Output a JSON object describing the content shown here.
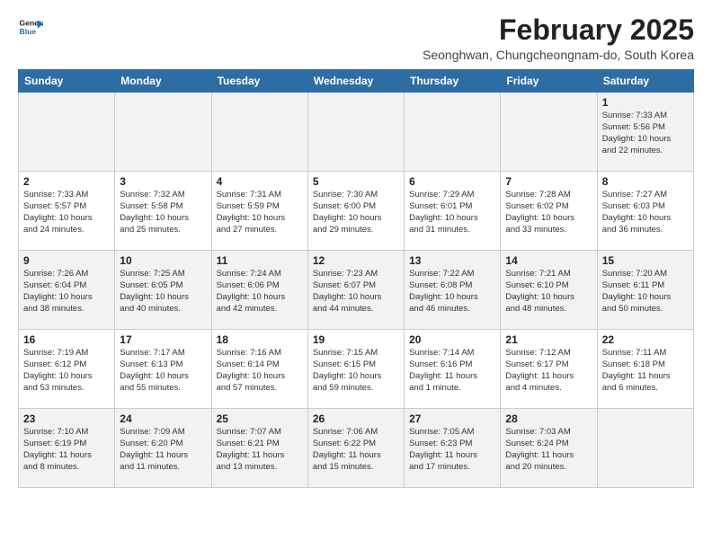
{
  "header": {
    "logo_line1": "General",
    "logo_line2": "Blue",
    "main_title": "February 2025",
    "subtitle": "Seonghwan, Chungcheongnam-do, South Korea"
  },
  "weekdays": [
    "Sunday",
    "Monday",
    "Tuesday",
    "Wednesday",
    "Thursday",
    "Friday",
    "Saturday"
  ],
  "weeks": [
    [
      {
        "day": "",
        "info": ""
      },
      {
        "day": "",
        "info": ""
      },
      {
        "day": "",
        "info": ""
      },
      {
        "day": "",
        "info": ""
      },
      {
        "day": "",
        "info": ""
      },
      {
        "day": "",
        "info": ""
      },
      {
        "day": "1",
        "info": "Sunrise: 7:33 AM\nSunset: 5:56 PM\nDaylight: 10 hours\nand 22 minutes."
      }
    ],
    [
      {
        "day": "2",
        "info": "Sunrise: 7:33 AM\nSunset: 5:57 PM\nDaylight: 10 hours\nand 24 minutes."
      },
      {
        "day": "3",
        "info": "Sunrise: 7:32 AM\nSunset: 5:58 PM\nDaylight: 10 hours\nand 25 minutes."
      },
      {
        "day": "4",
        "info": "Sunrise: 7:31 AM\nSunset: 5:59 PM\nDaylight: 10 hours\nand 27 minutes."
      },
      {
        "day": "5",
        "info": "Sunrise: 7:30 AM\nSunset: 6:00 PM\nDaylight: 10 hours\nand 29 minutes."
      },
      {
        "day": "6",
        "info": "Sunrise: 7:29 AM\nSunset: 6:01 PM\nDaylight: 10 hours\nand 31 minutes."
      },
      {
        "day": "7",
        "info": "Sunrise: 7:28 AM\nSunset: 6:02 PM\nDaylight: 10 hours\nand 33 minutes."
      },
      {
        "day": "8",
        "info": "Sunrise: 7:27 AM\nSunset: 6:03 PM\nDaylight: 10 hours\nand 36 minutes."
      }
    ],
    [
      {
        "day": "9",
        "info": "Sunrise: 7:26 AM\nSunset: 6:04 PM\nDaylight: 10 hours\nand 38 minutes."
      },
      {
        "day": "10",
        "info": "Sunrise: 7:25 AM\nSunset: 6:05 PM\nDaylight: 10 hours\nand 40 minutes."
      },
      {
        "day": "11",
        "info": "Sunrise: 7:24 AM\nSunset: 6:06 PM\nDaylight: 10 hours\nand 42 minutes."
      },
      {
        "day": "12",
        "info": "Sunrise: 7:23 AM\nSunset: 6:07 PM\nDaylight: 10 hours\nand 44 minutes."
      },
      {
        "day": "13",
        "info": "Sunrise: 7:22 AM\nSunset: 6:08 PM\nDaylight: 10 hours\nand 46 minutes."
      },
      {
        "day": "14",
        "info": "Sunrise: 7:21 AM\nSunset: 6:10 PM\nDaylight: 10 hours\nand 48 minutes."
      },
      {
        "day": "15",
        "info": "Sunrise: 7:20 AM\nSunset: 6:11 PM\nDaylight: 10 hours\nand 50 minutes."
      }
    ],
    [
      {
        "day": "16",
        "info": "Sunrise: 7:19 AM\nSunset: 6:12 PM\nDaylight: 10 hours\nand 53 minutes."
      },
      {
        "day": "17",
        "info": "Sunrise: 7:17 AM\nSunset: 6:13 PM\nDaylight: 10 hours\nand 55 minutes."
      },
      {
        "day": "18",
        "info": "Sunrise: 7:16 AM\nSunset: 6:14 PM\nDaylight: 10 hours\nand 57 minutes."
      },
      {
        "day": "19",
        "info": "Sunrise: 7:15 AM\nSunset: 6:15 PM\nDaylight: 10 hours\nand 59 minutes."
      },
      {
        "day": "20",
        "info": "Sunrise: 7:14 AM\nSunset: 6:16 PM\nDaylight: 11 hours\nand 1 minute."
      },
      {
        "day": "21",
        "info": "Sunrise: 7:12 AM\nSunset: 6:17 PM\nDaylight: 11 hours\nand 4 minutes."
      },
      {
        "day": "22",
        "info": "Sunrise: 7:11 AM\nSunset: 6:18 PM\nDaylight: 11 hours\nand 6 minutes."
      }
    ],
    [
      {
        "day": "23",
        "info": "Sunrise: 7:10 AM\nSunset: 6:19 PM\nDaylight: 11 hours\nand 8 minutes."
      },
      {
        "day": "24",
        "info": "Sunrise: 7:09 AM\nSunset: 6:20 PM\nDaylight: 11 hours\nand 11 minutes."
      },
      {
        "day": "25",
        "info": "Sunrise: 7:07 AM\nSunset: 6:21 PM\nDaylight: 11 hours\nand 13 minutes."
      },
      {
        "day": "26",
        "info": "Sunrise: 7:06 AM\nSunset: 6:22 PM\nDaylight: 11 hours\nand 15 minutes."
      },
      {
        "day": "27",
        "info": "Sunrise: 7:05 AM\nSunset: 6:23 PM\nDaylight: 11 hours\nand 17 minutes."
      },
      {
        "day": "28",
        "info": "Sunrise: 7:03 AM\nSunset: 6:24 PM\nDaylight: 11 hours\nand 20 minutes."
      },
      {
        "day": "",
        "info": ""
      }
    ]
  ]
}
